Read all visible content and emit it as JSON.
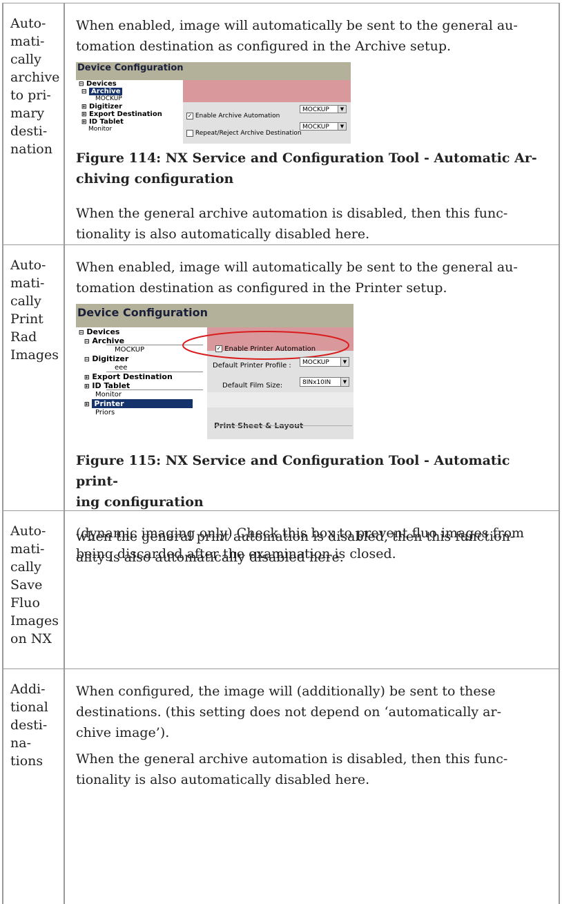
{
  "rows": [
    {
      "label_lines": [
        "Auto-",
        "mati-",
        "cally",
        "archive",
        "to pri-",
        "mary",
        "desti-",
        "nation"
      ],
      "intro": "When enabled, image will automatically be sent to the general au-tomation destination as configured in the Archive setup.",
      "intro_lines": [
        "When enabled, image will automatically be sent to the general au-",
        "tomation destination as configured in the Archive setup."
      ],
      "figure": {
        "header": "Device Configuration",
        "tree": [
          "Devices",
          "Archive",
          "MOCKUP",
          "Digitizer",
          "Export Destination",
          "ID Tablet",
          "Monitor"
        ],
        "options": [
          {
            "label": "Enable Archive Automation",
            "checked": true,
            "value": "MOCKUP"
          },
          {
            "label": "Repeat/Reject Archive Destination",
            "checked": false,
            "value": "MOCKUP"
          }
        ]
      },
      "caption_lines": [
        "Figure 114: NX Service and Configuration Tool - Automatic Ar-",
        "chiving configuration"
      ],
      "note_lines": [
        "When the general archive automation is disabled, then this func-",
        "tionality is also automatically disabled here."
      ]
    },
    {
      "label_lines": [
        "Auto-",
        "mati-",
        "cally",
        "Print",
        "Rad",
        "Images"
      ],
      "intro_lines": [
        "When enabled, image will automatically be sent to the general au-",
        "tomation destination as configured in the Printer setup."
      ],
      "figure": {
        "header": "Device Configuration",
        "tree": [
          "Devices",
          "Archive",
          "MOCKUP",
          "Digitizer",
          "eee",
          "Export Destination",
          "ID Tablet",
          "Monitor",
          "Printer",
          "Priors"
        ],
        "enable_label": "Enable Printer Automation",
        "fields": [
          {
            "label": "Default Printer Profile :",
            "value": "MOCKUP"
          },
          {
            "label": "Default Film Size:",
            "value": "8INx10IN"
          }
        ],
        "section": "Print Sheet & Layout"
      },
      "caption_lines": [
        "Figure 115: NX Service and Configuration Tool - Automatic print-",
        "ing configuration"
      ],
      "note_lines": [
        "when the general print automation is disabled, then this function-",
        "ality is also automatically disabled here."
      ]
    },
    {
      "label_lines": [
        "Auto-",
        "mati-",
        "cally",
        "Save",
        "Fluo",
        "Images",
        "on NX"
      ],
      "text_lines": [
        "(dynamic imaging only) Check this box to prevent fluo images from",
        "being discarded after the examination is closed."
      ]
    },
    {
      "label_lines": [
        "Addi-",
        "tional",
        "desti-",
        "na-",
        "tions"
      ],
      "text_lines": [
        "When configured, the image will (additionally) be sent to these",
        "destinations. (this setting does not depend on ‘automatically ar-",
        "chive image’)."
      ],
      "text2_lines": [
        "When the general archive automation is disabled, then this func-",
        "tionality is also automatically disabled here."
      ]
    }
  ]
}
